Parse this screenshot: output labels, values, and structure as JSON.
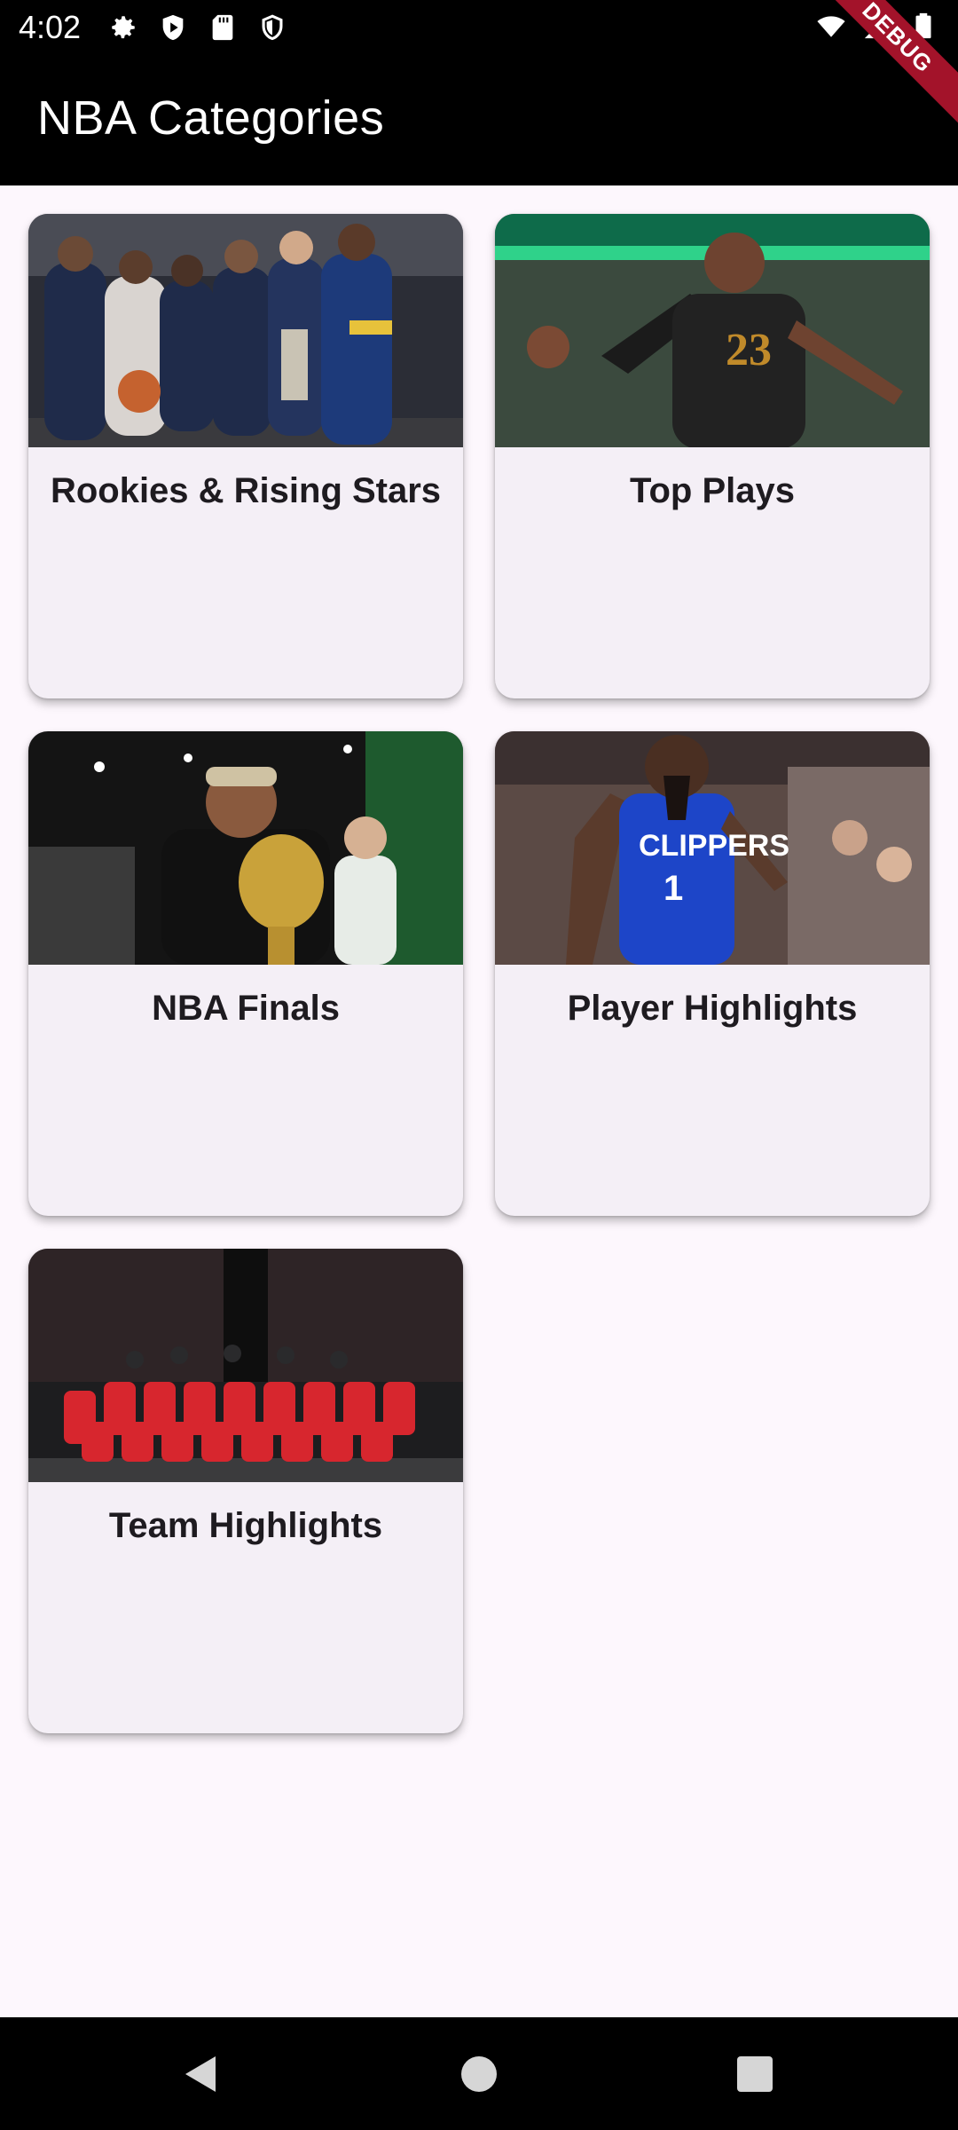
{
  "status_bar": {
    "time": "4:02",
    "left_icons": [
      "gear-icon",
      "shield-play-icon",
      "sd-card-icon",
      "shield-icon"
    ],
    "right_icons": [
      "wifi-icon",
      "cellular-icon",
      "battery-icon"
    ]
  },
  "app_bar": {
    "title": "NBA Categories"
  },
  "debug_banner": "DEBUG",
  "categories": [
    {
      "label": "Rookies & Rising Stars",
      "image": "rising-stars-team-photo"
    },
    {
      "label": "Top Plays",
      "image": "player-cavaliers-23"
    },
    {
      "label": "NBA Finals",
      "image": "finals-trophy-celebration"
    },
    {
      "label": "Player Highlights",
      "image": "player-clippers-1"
    },
    {
      "label": "Team Highlights",
      "image": "bulls-team-photo"
    }
  ],
  "nav_bar": {
    "buttons": [
      "back-icon",
      "home-icon",
      "recents-icon"
    ]
  },
  "colors": {
    "app_bar": "#000000",
    "background": "#fdf7fd",
    "card": "#f4eff6",
    "card_text": "#1e1b20",
    "debug_ribbon": "#a3132a"
  }
}
